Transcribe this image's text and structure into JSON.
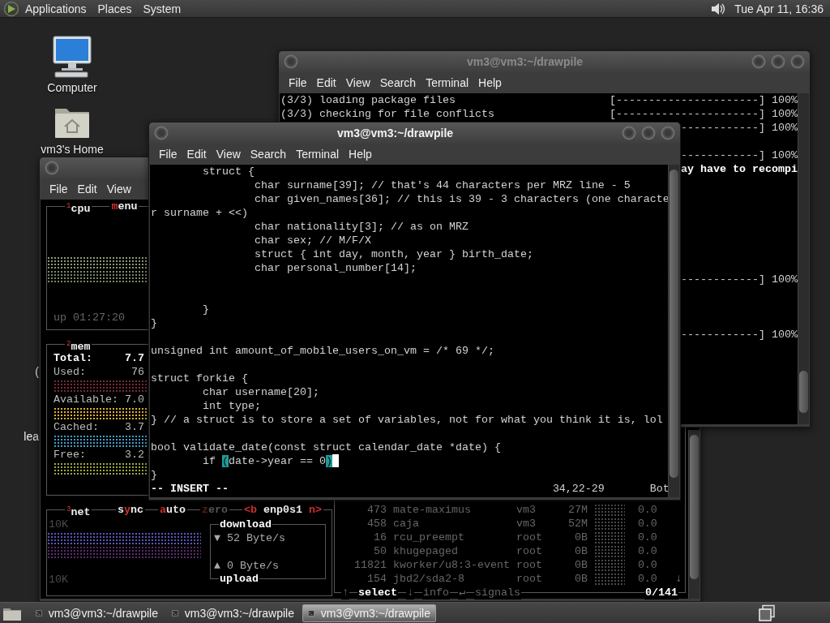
{
  "top_panel": {
    "menus": [
      "Applications",
      "Places",
      "System"
    ],
    "clock": "Tue Apr 11, 16:36"
  },
  "desktop_icons": [
    {
      "kind": "computer",
      "label": "Computer"
    },
    {
      "kind": "home",
      "label": "vm3's Home"
    }
  ],
  "desktop_fragments": [
    "(",
    "lea"
  ],
  "monitor_window": {
    "menu": [
      "File",
      "Edit",
      "View"
    ],
    "cpu": {
      "title": "$^{1}$cpu",
      "option": {
        "active": true,
        "parts": [
          {
            "text": "m",
            "hotkey": true
          },
          {
            "text": "enu",
            "hotkey": false
          }
        ]
      },
      "uptime": "up 01:27:20"
    },
    "mem": {
      "title": "$^{2}$mem",
      "rows": [
        {
          "kind": "total",
          "label": "Total:",
          "value": "7.7"
        },
        {
          "kind": "meter",
          "label": "Used:",
          "value": "76",
          "color": "#7a2a34"
        },
        {
          "kind": "meter",
          "label": "Available:",
          "value": "7.0",
          "color": "#e0b030"
        },
        {
          "kind": "meter",
          "label": "Cached:",
          "value": "3.7",
          "color": "#40a0c8"
        },
        {
          "kind": "meter",
          "label": "Free:",
          "value": "3.2",
          "color": "#a0a838"
        }
      ]
    },
    "net": {
      "title": "$^{3}$net",
      "options": [
        {
          "active": true,
          "parts": [
            {
              "text": "s",
              "hotkey": false
            },
            {
              "text": "y",
              "hotkey": true
            },
            {
              "text": "nc",
              "hotkey": false
            }
          ]
        },
        {
          "active": true,
          "parts": [
            {
              "text": "a",
              "hotkey": true
            },
            {
              "text": "uto",
              "hotkey": false
            }
          ]
        },
        {
          "active": false,
          "parts": [
            {
              "text": "z",
              "hotkey": true
            },
            {
              "text": "ero",
              "hotkey": false
            }
          ]
        },
        {
          "active": true,
          "parts": [
            {
              "text": "<b",
              "hotkey": true
            },
            {
              "text": " enp0s1 ",
              "hotkey": false
            },
            {
              "text": "n>",
              "hotkey": true
            }
          ]
        }
      ],
      "scale_top": "10K",
      "scale_bottom": "10K",
      "download": {
        "title": "download",
        "reading": "▼ 52 Byte/s"
      },
      "upload": {
        "title": "upload",
        "reading": "▲ 0 Byte/s"
      }
    },
    "processes": {
      "rows": [
        {
          "pid": "473",
          "name": "mate-maximus",
          "user": "vm3",
          "memory": "27M",
          "cpu": "0.0"
        },
        {
          "pid": "458",
          "name": "caja",
          "user": "vm3",
          "memory": "52M",
          "cpu": "0.0"
        },
        {
          "pid": "16",
          "name": "rcu_preempt",
          "user": "root",
          "memory": "0B",
          "cpu": "0.0"
        },
        {
          "pid": "50",
          "name": "khugepaged",
          "user": "root",
          "memory": "0B",
          "cpu": "0.0"
        },
        {
          "pid": "11821",
          "name": "kworker/u8:3-event",
          "user": "root",
          "memory": "0B",
          "cpu": "0.0"
        },
        {
          "pid": "154",
          "name": "jbd2/sda2-8",
          "user": "root",
          "memory": "0B",
          "cpu": "0.0"
        }
      ],
      "scroll_indicator": "↓",
      "footer": [
        {
          "text": "↑",
          "active": false
        },
        {
          "text": "select",
          "active": true
        },
        {
          "text": "↓",
          "active": false
        },
        {
          "text": "info",
          "active": false
        },
        {
          "text": "↵",
          "active": false
        },
        {
          "text": "signals",
          "active": false
        }
      ],
      "count": "0/141"
    }
  },
  "back_terminal": {
    "title": "vm3@vm3:~/drawpile",
    "active": false,
    "menu": [
      "File",
      "Edit",
      "View",
      "Search",
      "Terminal",
      "Help"
    ],
    "lines": [
      {
        "kind": "progress",
        "text": "(3/3) loading package files",
        "bar": "[----------------------] 100%"
      },
      {
        "kind": "progress",
        "text": "(3/3) checking for file conflicts",
        "bar": "[----------------------] 100%"
      },
      {
        "kind": "partial",
        "bar": "------------] 100%"
      },
      {
        "kind": "blank"
      },
      {
        "kind": "partial",
        "bar": "------------] 100%"
      },
      {
        "kind": "partial_bold",
        "text": "ay have to recompi"
      },
      {
        "kind": "blank"
      },
      {
        "kind": "blank"
      },
      {
        "kind": "blank"
      },
      {
        "kind": "blank"
      },
      {
        "kind": "blank"
      },
      {
        "kind": "blank"
      },
      {
        "kind": "blank"
      },
      {
        "kind": "partial",
        "bar": "------------] 100%"
      },
      {
        "kind": "blank"
      },
      {
        "kind": "blank"
      },
      {
        "kind": "blank"
      },
      {
        "kind": "partial",
        "bar": "------------] 100%"
      }
    ]
  },
  "front_terminal": {
    "title": "vm3@vm3:~/drawpile",
    "active": true,
    "menu": [
      "File",
      "Edit",
      "View",
      "Search",
      "Terminal",
      "Help"
    ],
    "lines": [
      {
        "kind": "code",
        "text": "        struct {"
      },
      {
        "kind": "code",
        "text": "                char surname[39]; // that's 44 characters per MRZ line - 5"
      },
      {
        "kind": "code",
        "text": "                char given_names[36]; // this is 39 - 3 characters (one characte"
      },
      {
        "kind": "code",
        "text": "r surname + <<)"
      },
      {
        "kind": "code",
        "text": "                char nationality[3]; // as on MRZ"
      },
      {
        "kind": "code",
        "text": "                char sex; // M/F/X"
      },
      {
        "kind": "code",
        "text": "                struct { int day, month, year } birth_date;"
      },
      {
        "kind": "code",
        "text": "                char personal_number[14];"
      },
      {
        "kind": "blank"
      },
      {
        "kind": "blank"
      },
      {
        "kind": "code",
        "text": "        }"
      },
      {
        "kind": "code",
        "text": "}"
      },
      {
        "kind": "blank"
      },
      {
        "kind": "code",
        "text": "unsigned int amount_of_mobile_users_on_vm = /* 69 */;"
      },
      {
        "kind": "blank"
      },
      {
        "kind": "code",
        "text": "struct forkie {"
      },
      {
        "kind": "code",
        "text": "        char username[20];"
      },
      {
        "kind": "code",
        "text": "        int type;"
      },
      {
        "kind": "code",
        "text": "} // a struct is to store a set of variables, not for what you think it is, lol"
      },
      {
        "kind": "blank"
      },
      {
        "kind": "code",
        "text": "bool validate_date(const struct calendar_date *date) {"
      },
      {
        "kind": "segments",
        "segments": [
          {
            "kind": "text",
            "text": "        if "
          },
          {
            "kind": "match",
            "text": "("
          },
          {
            "kind": "text",
            "text": "date->year == 0"
          },
          {
            "kind": "match",
            "text": ")"
          },
          {
            "kind": "cursor"
          }
        ]
      },
      {
        "kind": "code",
        "text": "}"
      }
    ],
    "status": {
      "mode": "-- INSERT --",
      "position": "34,22-29",
      "scroll": "Bot"
    }
  },
  "taskbar": {
    "tasks": [
      {
        "label": "vm3@vm3:~/drawpile",
        "selected": false
      },
      {
        "label": "vm3@vm3:~/drawpile",
        "selected": false
      },
      {
        "label": "vm3@vm3:~/drawpile",
        "selected": true
      }
    ]
  }
}
